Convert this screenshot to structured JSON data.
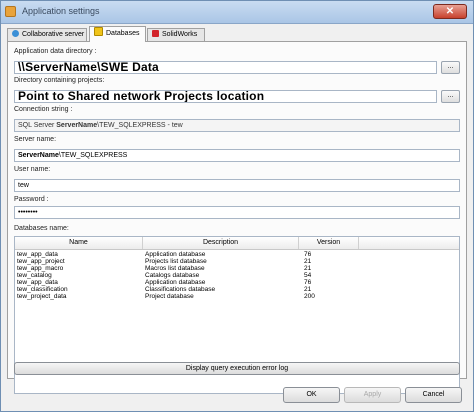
{
  "window": {
    "title": "Application settings",
    "close_glyph": "✕"
  },
  "tabs": [
    {
      "label": "Collaborative server",
      "icon": "collaborative-server-icon"
    },
    {
      "label": "Databases",
      "icon": "database-icon"
    },
    {
      "label": "SolidWorks",
      "icon": "solidworks-icon"
    }
  ],
  "fields": {
    "app_data_dir": {
      "label": "Application data directory :",
      "value": "\\\\ServerName\\SWE  Data"
    },
    "projects_dir": {
      "label": "Directory containing projects:",
      "value": "Point to Shared network Projects location"
    },
    "connection": {
      "label": "Connection string :",
      "value_prefix": "SQL Server ",
      "value_bold": "ServerName",
      "value_suffix": "\\TEW_SQLEXPRESS - tew"
    },
    "server": {
      "label": "Server name:",
      "value_bold": "ServerName",
      "value_suffix": "\\TEW_SQLEXPRESS"
    },
    "user": {
      "label": "User name:",
      "value": "tew"
    },
    "password": {
      "label": "Password :",
      "value": "••••••••"
    }
  },
  "browse_label": "...",
  "databases": {
    "label": "Databases name:",
    "columns": [
      "Name",
      "Description",
      "Version"
    ],
    "rows": [
      {
        "name": "tew_app_data",
        "description": "Application database",
        "version": "76"
      },
      {
        "name": "tew_app_project",
        "description": "Projects list database",
        "version": "21"
      },
      {
        "name": "tew_app_macro",
        "description": "Macros list database",
        "version": "21"
      },
      {
        "name": "tew_catalog",
        "description": "Catalogs database",
        "version": "54"
      },
      {
        "name": "tew_app_data",
        "description": "Application database",
        "version": "76"
      },
      {
        "name": "tew_classification",
        "description": "Classifications database",
        "version": "21"
      },
      {
        "name": "tew_project_data",
        "description": "Project database",
        "version": "200"
      }
    ]
  },
  "buttons": {
    "query_log": "Display query execution error log",
    "ok": "OK",
    "apply": "Apply",
    "cancel": "Cancel"
  },
  "colors": {
    "title_bar": "#aac6e6",
    "close": "#c7412d"
  }
}
